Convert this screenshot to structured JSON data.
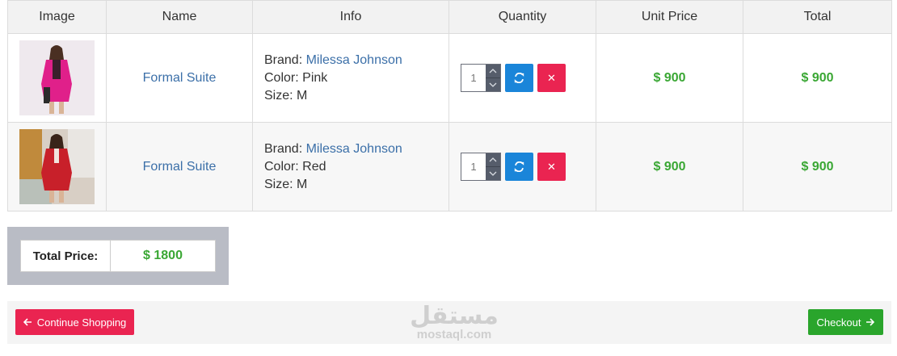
{
  "table": {
    "headers": [
      "Image",
      "Name",
      "Info",
      "Quantity",
      "Unit Price",
      "Total"
    ],
    "rows": [
      {
        "name": "Formal Suite",
        "brand_label": "Brand:",
        "brand": "Milessa Johnson",
        "color_label": "Color:",
        "color": "Pink",
        "size_label": "Size:",
        "size": "M",
        "quantity": "1",
        "unit_price": "$ 900",
        "total": "$ 900",
        "image_color": "#e0208a"
      },
      {
        "name": "Formal Suite",
        "brand_label": "Brand:",
        "brand": "Milessa Johnson",
        "color_label": "Color:",
        "color": "Red",
        "size_label": "Size:",
        "size": "M",
        "quantity": "1",
        "unit_price": "$ 900",
        "total": "$ 900",
        "image_color": "#c8202a"
      }
    ]
  },
  "summary": {
    "total_label": "Total Price:",
    "total_value": "$ 1800"
  },
  "footer": {
    "continue_label": "Continue Shopping",
    "checkout_label": "Checkout"
  },
  "watermark": {
    "arabic": "مستقل",
    "latin": "mostaql.com"
  },
  "colors": {
    "price_green": "#3aa734",
    "danger_red": "#ea2451",
    "refresh_blue": "#1a85d9",
    "link_blue": "#3b6fa8"
  },
  "icons": {
    "refresh": "refresh-icon",
    "remove": "close-icon",
    "continue": "arrow-left-icon",
    "checkout": "arrow-right-icon",
    "spin_up": "chevron-up-icon",
    "spin_down": "chevron-down-icon"
  }
}
